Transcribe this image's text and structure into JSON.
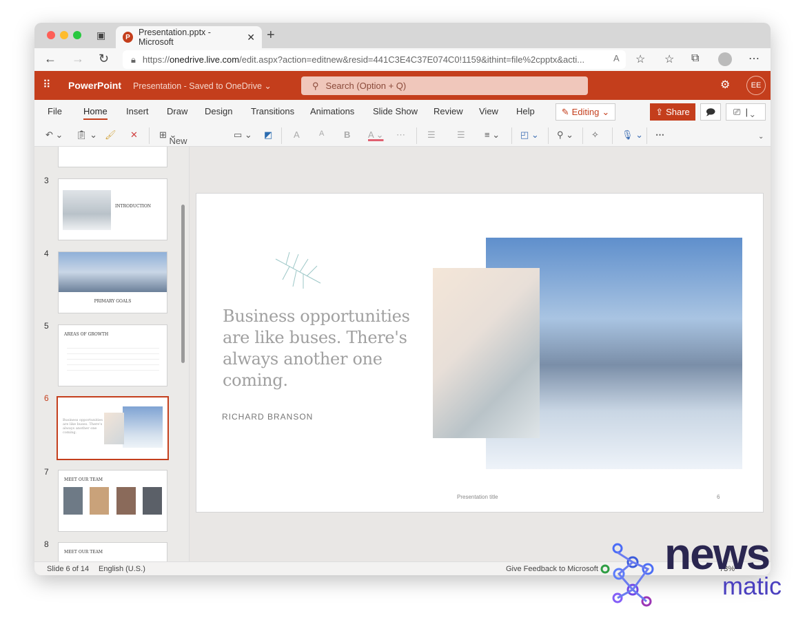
{
  "browser": {
    "tab_title": "Presentation.pptx - Microsoft",
    "url_prefix": "https://",
    "url_domain": "onedrive.live.com",
    "url_rest": "/edit.aspx?action=editnew&resid=441C3E4C37E074C0!1159&ithint=file%2cpptx&acti..."
  },
  "header": {
    "app_name": "PowerPoint",
    "doc_title": "Presentation",
    "save_status": "Saved to OneDrive",
    "search_placeholder": "Search (Option + Q)",
    "avatar_initials": "EE",
    "brand_color": "#c43e1c"
  },
  "ribbon": {
    "tabs": [
      "File",
      "Home",
      "Insert",
      "Draw",
      "Design",
      "Transitions",
      "Animations",
      "Slide Show",
      "Review",
      "View",
      "Help"
    ],
    "active_tab": "Home",
    "editing_label": "Editing",
    "share_label": "Share",
    "new_slide_label": "New Slide"
  },
  "thumbnails": [
    {
      "number": "3",
      "title": "INTRODUCTION"
    },
    {
      "number": "4",
      "title": "PRIMARY GOALS"
    },
    {
      "number": "5",
      "title": "AREAS OF GROWTH"
    },
    {
      "number": "6",
      "title": "Business opportunities are like buses. There's always another one coming."
    },
    {
      "number": "7",
      "title": "MEET OUR TEAM"
    },
    {
      "number": "8",
      "title": "MEET OUR TEAM"
    }
  ],
  "slide": {
    "quote": "Business opportunities are like buses. There's always another one coming.",
    "author": "RICHARD BRANSON",
    "footer": "Presentation title",
    "page_number": "6"
  },
  "status": {
    "slide_info": "Slide 6 of 14",
    "language": "English (U.S.)",
    "feedback": "Give Feedback to Microsoft",
    "zoom": "73%"
  },
  "watermark": {
    "line1": "news",
    "line2": "matic"
  }
}
